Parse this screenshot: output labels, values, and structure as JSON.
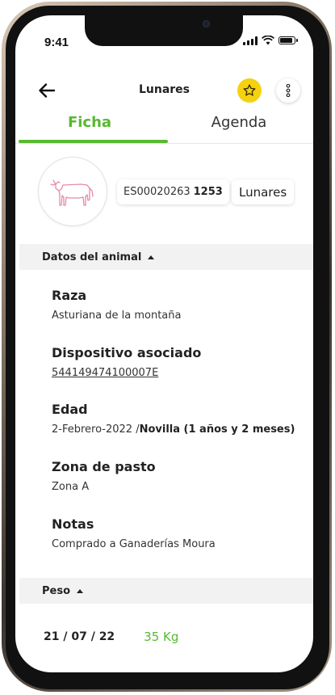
{
  "status_bar": {
    "time": "9:41"
  },
  "header": {
    "title": "Lunares",
    "back_icon": "arrow-left-icon",
    "favorite_icon": "star-icon",
    "menu_icon": "more-vertical-icon",
    "favorite_color": "#f5d20f"
  },
  "tabs": [
    {
      "label": "Ficha",
      "active": true
    },
    {
      "label": "Agenda",
      "active": false
    }
  ],
  "animal": {
    "id_prefix": "ES00020263",
    "id_suffix": "1253",
    "name": "Lunares",
    "avatar_icon": "cow-icon"
  },
  "sections": {
    "datos": {
      "title": "Datos del animal",
      "fields": [
        {
          "label": "Raza",
          "value": "Asturiana de la montaña"
        },
        {
          "label": "Dispositivo asociado",
          "value": "544149474100007E"
        },
        {
          "label": "Edad",
          "value": "2-Febrero-2022 /",
          "value_bold": "Novilla (1 años y 2 meses)"
        },
        {
          "label": "Zona de pasto",
          "value": "Zona A"
        },
        {
          "label": "Notas",
          "value": "Comprado a Ganaderías Moura"
        }
      ]
    },
    "peso": {
      "title": "Peso",
      "entries": [
        {
          "date": "21 / 07 / 22",
          "weight": "35 Kg"
        }
      ]
    }
  },
  "colors": {
    "accent": "#58b932",
    "section_bg": "#f2f2f2",
    "avatar_icon": "#e58aa8"
  }
}
